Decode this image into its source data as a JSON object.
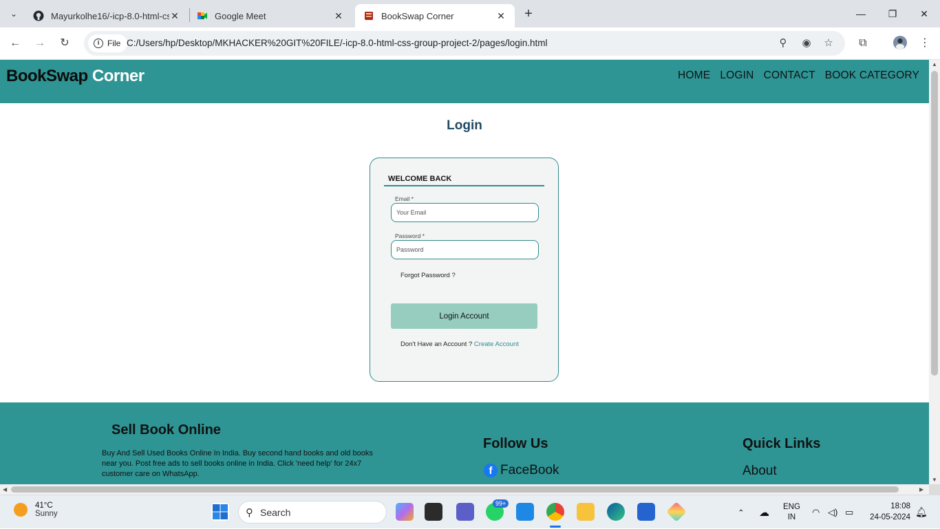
{
  "browser": {
    "tabs": [
      {
        "title": "Mayurkolhe16/-icp-8.0-html-cs",
        "favicon": "github-icon"
      },
      {
        "title": "Google Meet",
        "favicon": "google-meet-icon"
      },
      {
        "title": "BookSwap Corner",
        "favicon": "book-icon",
        "active": true
      }
    ],
    "omnibox": {
      "scheme_label": "File",
      "url": "C:/Users/hp/Desktop/MKHACKER%20GIT%20FILE/-icp-8.0-html-css-group-project-2/pages/login.html"
    }
  },
  "site": {
    "brand_part1": "BookSwap",
    "brand_part2": "Corner",
    "nav": [
      "HOME",
      "LOGIN",
      "CONTACT",
      "BOOK CATEGORY"
    ]
  },
  "login": {
    "page_title": "Login",
    "welcome": "WELCOME BACK",
    "email_label": "Email *",
    "email_placeholder": "Your Email",
    "password_label": "Password *",
    "password_placeholder": "Password",
    "forgot_text": "Forgot Password ?",
    "submit_label": "Login Account",
    "no_account_text": "Don't Have an Account ?",
    "create_link": "Create Account"
  },
  "footer": {
    "sell_title": "Sell Book Online",
    "sell_text": "Buy And Sell Used Books Online In India. Buy second hand books and old books near you. Post free ads to sell books online in India. Click 'need help' for 24x7 customer care on WhatsApp.",
    "follow_title": "Follow Us",
    "facebook_label": "FaceBook",
    "quick_title": "Quick Links",
    "about_label": "About"
  },
  "taskbar": {
    "temperature": "41°C",
    "weather": "Sunny",
    "search_label": "Search",
    "whatsapp_badge": "99+",
    "lang_line1": "ENG",
    "lang_line2": "IN",
    "time": "18:08",
    "date": "24-05-2024"
  },
  "colors": {
    "teal": "#2e9494",
    "button": "#97cdbf",
    "title": "#1f4a63"
  }
}
